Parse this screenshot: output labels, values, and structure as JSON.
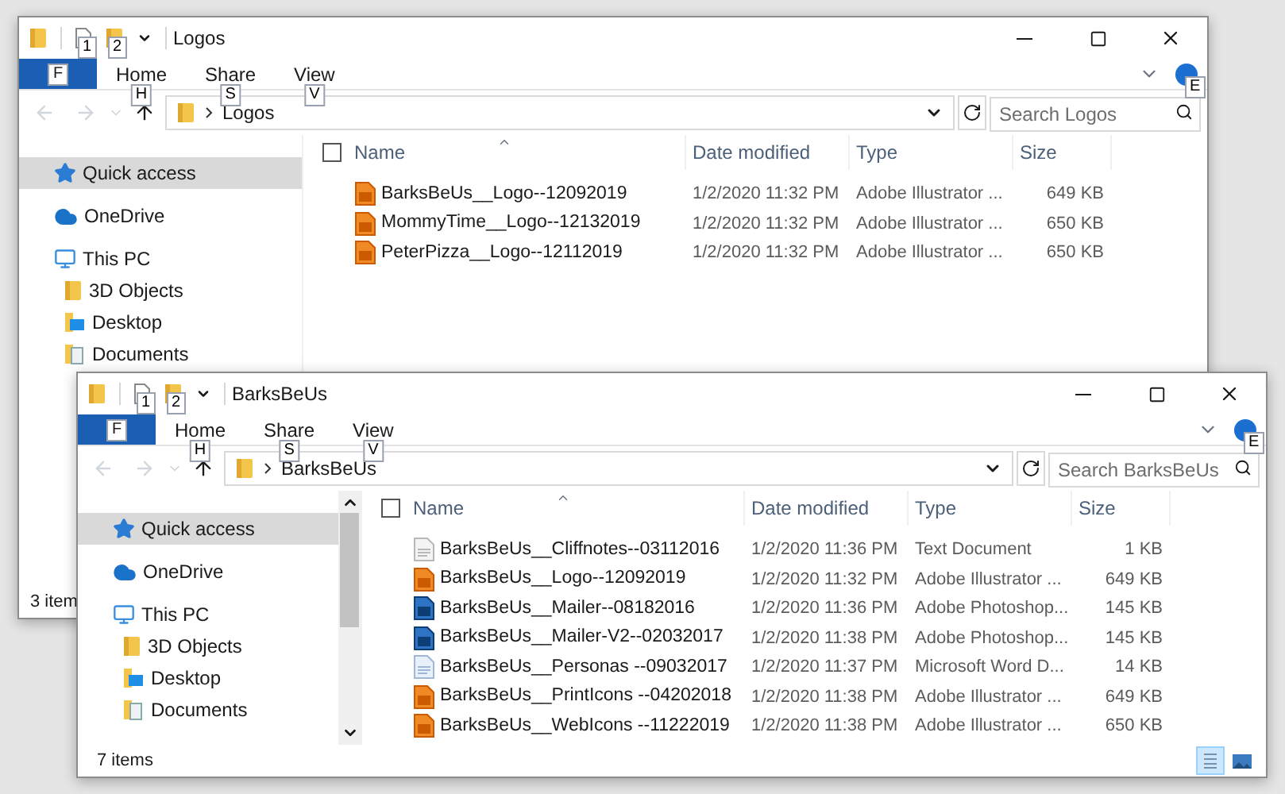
{
  "windows": [
    {
      "title": "Logos",
      "quick_access_keytips": [
        "1",
        "2"
      ],
      "file_tab_keytip": "F",
      "tabs": [
        {
          "label": "Home",
          "keytip": "H"
        },
        {
          "label": "Share",
          "keytip": "S"
        },
        {
          "label": "View",
          "keytip": "V"
        }
      ],
      "help_keytip": "E",
      "address": "Logos",
      "search_placeholder": "Search Logos",
      "sidebar": [
        {
          "label": "Quick access",
          "kind": "star",
          "selected": true
        },
        {
          "label": "OneDrive",
          "kind": "cloud",
          "selected": false
        },
        {
          "label": "This PC",
          "kind": "pc",
          "selected": false,
          "children": [
            {
              "label": "3D Objects",
              "kind": "objects",
              "selected": false
            },
            {
              "label": "Desktop",
              "kind": "desktop",
              "selected": false
            },
            {
              "label": "Documents",
              "kind": "documents",
              "selected": false
            }
          ]
        }
      ],
      "select_all_checked": false,
      "columns": [
        "Name",
        "Date modified",
        "Type",
        "Size"
      ],
      "files": [
        {
          "kind": "ai",
          "name": "BarksBeUs__Logo--12092019",
          "date": "1/2/2020 11:32 PM",
          "type": "Adobe Illustrator ...",
          "size": "649 KB"
        },
        {
          "kind": "ai",
          "name": "MommyTime__Logo--12132019",
          "date": "1/2/2020 11:32 PM",
          "type": "Adobe Illustrator ...",
          "size": "650 KB"
        },
        {
          "kind": "ai",
          "name": "PeterPizza__Logo--12112019",
          "date": "1/2/2020 11:32 PM",
          "type": "Adobe Illustrator ...",
          "size": "650 KB"
        }
      ],
      "status": "3 item"
    },
    {
      "title": "BarksBeUs",
      "quick_access_keytips": [
        "1",
        "2"
      ],
      "file_tab_keytip": "F",
      "tabs": [
        {
          "label": "Home",
          "keytip": "H"
        },
        {
          "label": "Share",
          "keytip": "S"
        },
        {
          "label": "View",
          "keytip": "V"
        }
      ],
      "help_keytip": "E",
      "address": "BarksBeUs",
      "search_placeholder": "Search BarksBeUs",
      "sidebar": [
        {
          "label": "Quick access",
          "kind": "star",
          "selected": true
        },
        {
          "label": "OneDrive",
          "kind": "cloud",
          "selected": false
        },
        {
          "label": "This PC",
          "kind": "pc",
          "selected": false,
          "children": [
            {
              "label": "3D Objects",
              "kind": "objects",
              "selected": false
            },
            {
              "label": "Desktop",
              "kind": "desktop",
              "selected": false
            },
            {
              "label": "Documents",
              "kind": "documents",
              "selected": false
            }
          ]
        }
      ],
      "sidebar_scrollbar": true,
      "select_all_checked": false,
      "columns": [
        "Name",
        "Date modified",
        "Type",
        "Size"
      ],
      "files": [
        {
          "kind": "text",
          "name": "BarksBeUs__Cliffnotes--03112016",
          "date": "1/2/2020 11:36 PM",
          "type": "Text Document",
          "size": "1 KB"
        },
        {
          "kind": "ai",
          "name": "BarksBeUs__Logo--12092019",
          "date": "1/2/2020 11:32 PM",
          "type": "Adobe Illustrator ...",
          "size": "649 KB"
        },
        {
          "kind": "ps",
          "name": "BarksBeUs__Mailer--08182016",
          "date": "1/2/2020 11:36 PM",
          "type": "Adobe Photoshop...",
          "size": "145 KB"
        },
        {
          "kind": "ps",
          "name": "BarksBeUs__Mailer-V2--02032017",
          "date": "1/2/2020 11:38 PM",
          "type": "Adobe Photoshop...",
          "size": "145 KB"
        },
        {
          "kind": "word",
          "name": "BarksBeUs__Personas --09032017",
          "date": "1/2/2020 11:37 PM",
          "type": "Microsoft Word D...",
          "size": "14 KB"
        },
        {
          "kind": "ai",
          "name": "BarksBeUs__PrintIcons --04202018",
          "date": "1/2/2020 11:38 PM",
          "type": "Adobe Illustrator ...",
          "size": "649 KB"
        },
        {
          "kind": "ai",
          "name": "BarksBeUs__WebIcons --11222019",
          "date": "1/2/2020 11:38 PM",
          "type": "Adobe Illustrator ...",
          "size": "650 KB"
        }
      ],
      "status": "7 items",
      "view_buttons": [
        {
          "kind": "details",
          "selected": true
        },
        {
          "kind": "large",
          "selected": false
        }
      ]
    }
  ]
}
